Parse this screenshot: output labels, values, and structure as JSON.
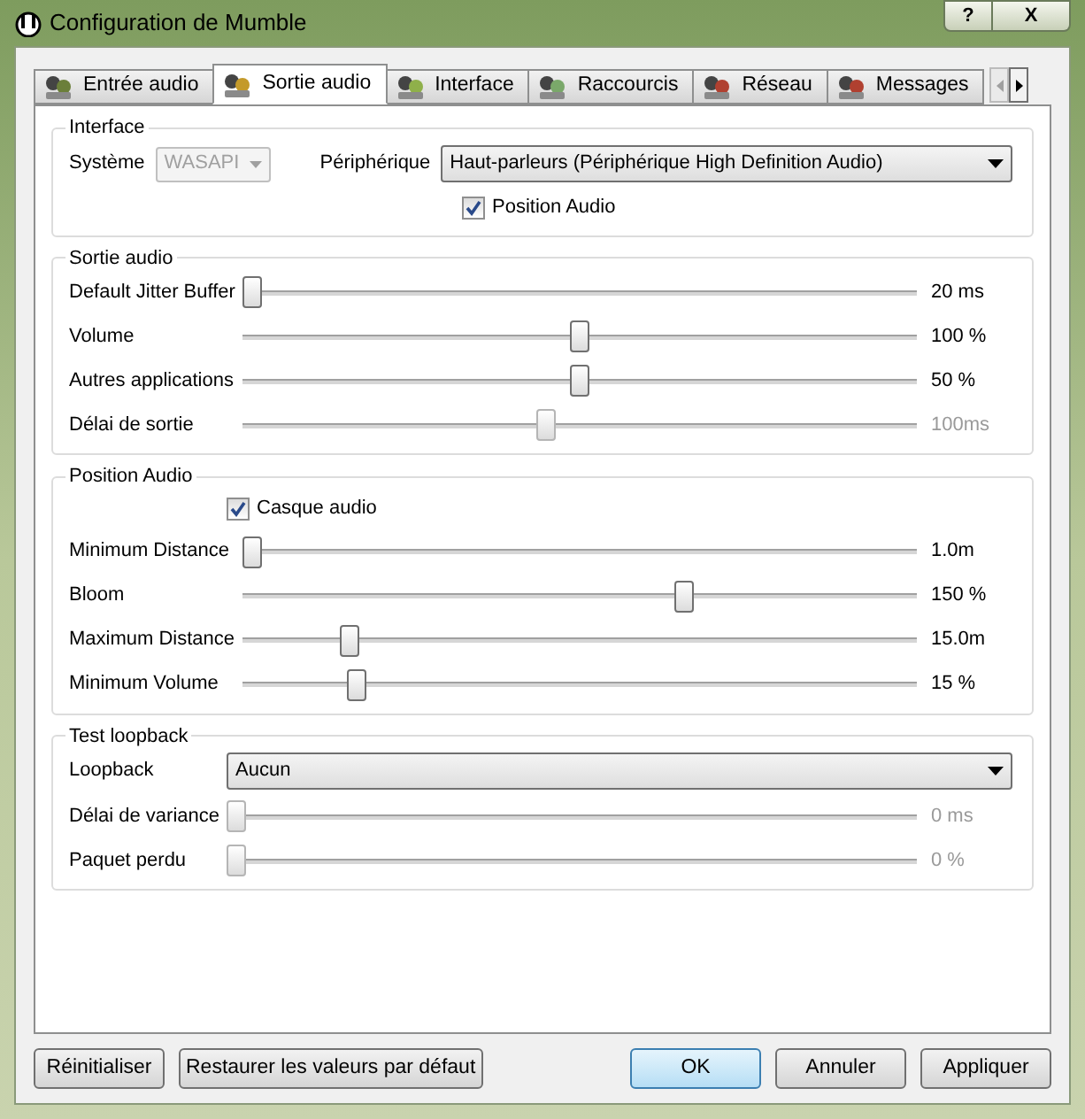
{
  "window": {
    "title": "Configuration de Mumble",
    "help_button": "?",
    "close_button": "X"
  },
  "tabs": [
    {
      "label": "Entrée audio",
      "selected": false
    },
    {
      "label": "Sortie audio",
      "selected": true
    },
    {
      "label": "Interface",
      "selected": false
    },
    {
      "label": "Raccourcis",
      "selected": false
    },
    {
      "label": "Réseau",
      "selected": false
    },
    {
      "label": "Messages",
      "selected": false
    }
  ],
  "groups": [
    {
      "title": "Interface",
      "rows": [
        {
          "kind": "device",
          "system_label": "Système",
          "system_value": "WASAPI",
          "system_disabled": true,
          "device_label": "Périphérique",
          "device_value": "Haut-parleurs (Périphérique High Definition Audio)"
        },
        {
          "kind": "checkbox",
          "label": "Position Audio",
          "checked": true
        }
      ]
    },
    {
      "title": "Sortie audio",
      "rows": [
        {
          "kind": "slider",
          "label": "Default Jitter Buffer",
          "level": 0,
          "reading": "20 ms",
          "disabled": false
        },
        {
          "kind": "slider",
          "label": "Volume",
          "level": 0.5,
          "reading": "100 %",
          "disabled": false
        },
        {
          "kind": "slider",
          "label": "Autres applications",
          "level": 0.5,
          "reading": "50 %",
          "disabled": false
        },
        {
          "kind": "slider",
          "label": "Délai de sortie",
          "level": 0.45,
          "reading": "100ms",
          "disabled": true
        }
      ]
    },
    {
      "title": "Position Audio",
      "rows": [
        {
          "kind": "checkbox",
          "label": "Casque audio",
          "checked": true
        },
        {
          "kind": "slider",
          "label": "Minimum Distance",
          "level": 0,
          "reading": "1.0m",
          "disabled": false
        },
        {
          "kind": "slider",
          "label": "Bloom",
          "level": 0.66,
          "reading": "150 %",
          "disabled": false
        },
        {
          "kind": "slider",
          "label": "Maximum Distance",
          "level": 0.15,
          "reading": "15.0m",
          "disabled": false
        },
        {
          "kind": "slider",
          "label": "Minimum Volume",
          "level": 0.16,
          "reading": "15 %",
          "disabled": false
        }
      ]
    },
    {
      "title": "Test loopback",
      "rows": [
        {
          "kind": "combo",
          "label": "Loopback",
          "value": "Aucun"
        },
        {
          "kind": "slider",
          "label": "Délai de variance",
          "level": 0,
          "reading": "0 ms",
          "disabled": true
        },
        {
          "kind": "slider",
          "label": "Paquet perdu",
          "level": 0,
          "reading": "0 %",
          "disabled": true
        }
      ]
    }
  ],
  "buttons_left": [
    "Réinitialiser",
    "Restaurer les valeurs par défaut"
  ],
  "buttons_right": [
    {
      "label": "OK",
      "default": true
    },
    {
      "label": "Annuler",
      "default": false
    },
    {
      "label": "Appliquer",
      "default": false
    }
  ]
}
